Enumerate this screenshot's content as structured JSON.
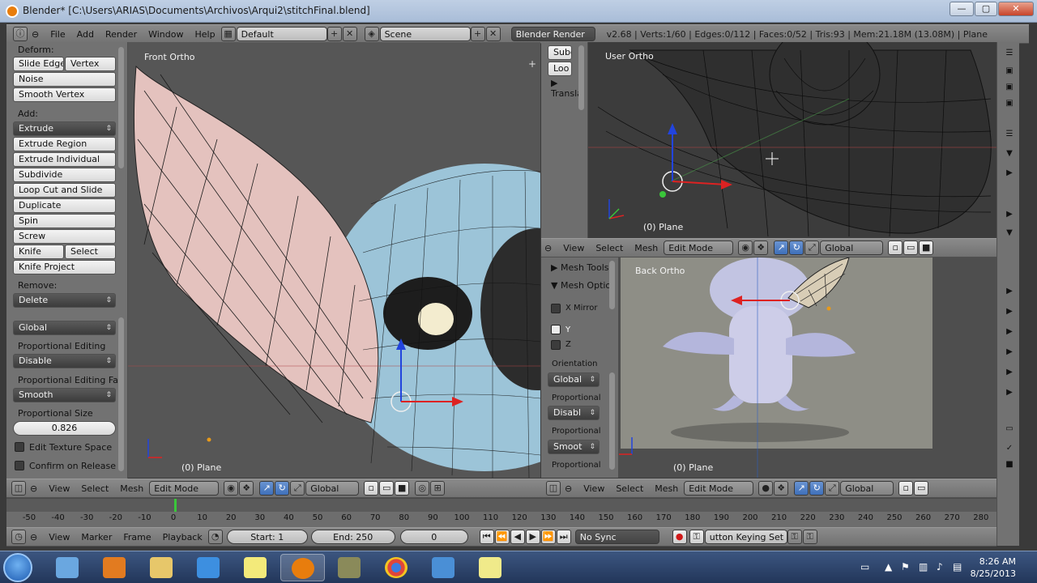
{
  "window": {
    "title": "Blender* [C:\\Users\\ARIAS\\Documents\\Archivos\\Arqui2\\stitchFinal.blend]",
    "min_label": "—",
    "max_label": "▢",
    "close_label": "✕"
  },
  "header": {
    "menus": [
      "File",
      "Add",
      "Render",
      "Window",
      "Help"
    ],
    "layout": "Default",
    "scene": "Scene",
    "engine": "Blender Render",
    "stats": "v2.68 | Verts:1/60 | Edges:0/112 | Faces:0/52 | Tris:93 | Mem:21.18M (13.08M) | Plane"
  },
  "toolshelf": {
    "deform_heading": "Deform:",
    "slide_edge": "Slide Edge",
    "vertex": "Vertex",
    "noise": "Noise",
    "smooth_vertex": "Smooth Vertex",
    "add_heading": "Add:",
    "extrude": "Extrude",
    "extrude_region": "Extrude Region",
    "extrude_individual": "Extrude Individual",
    "subdivide": "Subdivide",
    "loop_cut": "Loop Cut and Slide",
    "duplicate": "Duplicate",
    "spin": "Spin",
    "screw": "Screw",
    "knife": "Knife",
    "select": "Select",
    "knife_project": "Knife Project",
    "remove_heading": "Remove:",
    "delete": "Delete",
    "global": "Global",
    "prop_editing_label": "Proportional Editing",
    "prop_editing_value": "Disable",
    "prop_falloff_label": "Proportional Editing Fall",
    "prop_falloff_value": "Smooth",
    "prop_size_label": "Proportional Size",
    "prop_size_value": "0.826",
    "edit_texture_space": "Edit Texture Space",
    "confirm_on_release": "Confirm on Release"
  },
  "viewports": {
    "front": {
      "label": "Front Ortho",
      "object": "(0) Plane"
    },
    "user": {
      "label": "User Ortho",
      "object": "(0) Plane"
    },
    "back": {
      "label": "Back Ortho",
      "object": "(0) Plane"
    }
  },
  "mini_panel": {
    "subd": "Subd",
    "loo": "Loo",
    "transla": "Transla"
  },
  "side_panel": {
    "mesh_tools": "Mesh Tools",
    "mesh_options": "Mesh Optio",
    "x_mirror": "X Mirror",
    "y": "Y",
    "z": "Z",
    "orientation_label": "Orientation",
    "orientation_value": "Global",
    "proportional_label": "Proportional",
    "proportional_value": "Disabl",
    "proportional2_label": "Proportional",
    "proportional2_value": "Smoot",
    "proportional3_label": "Proportional"
  },
  "view3d_header": {
    "view": "View",
    "select": "Select",
    "mesh": "Mesh",
    "mode": "Edit Mode",
    "orientation": "Global"
  },
  "timeline": {
    "ticks": [
      "-50",
      "-40",
      "-30",
      "-20",
      "-10",
      "0",
      "10",
      "20",
      "30",
      "40",
      "50",
      "60",
      "70",
      "80",
      "90",
      "100",
      "110",
      "120",
      "130",
      "140",
      "150",
      "160",
      "170",
      "180",
      "190",
      "200",
      "210",
      "220",
      "230",
      "240",
      "250",
      "260",
      "270",
      "280"
    ],
    "view": "View",
    "marker": "Marker",
    "frame": "Frame",
    "playback": "Playback",
    "start": "Start: 1",
    "end": "End: 250",
    "current": "0",
    "sync": "No Sync",
    "keying": "utton Keying Set"
  },
  "taskbar": {
    "time": "8:26 AM",
    "date": "8/25/2013"
  },
  "colors": {
    "accent": "#5680c2",
    "viewport_bg": "#3f3f3f",
    "panel_bg": "#727272"
  }
}
